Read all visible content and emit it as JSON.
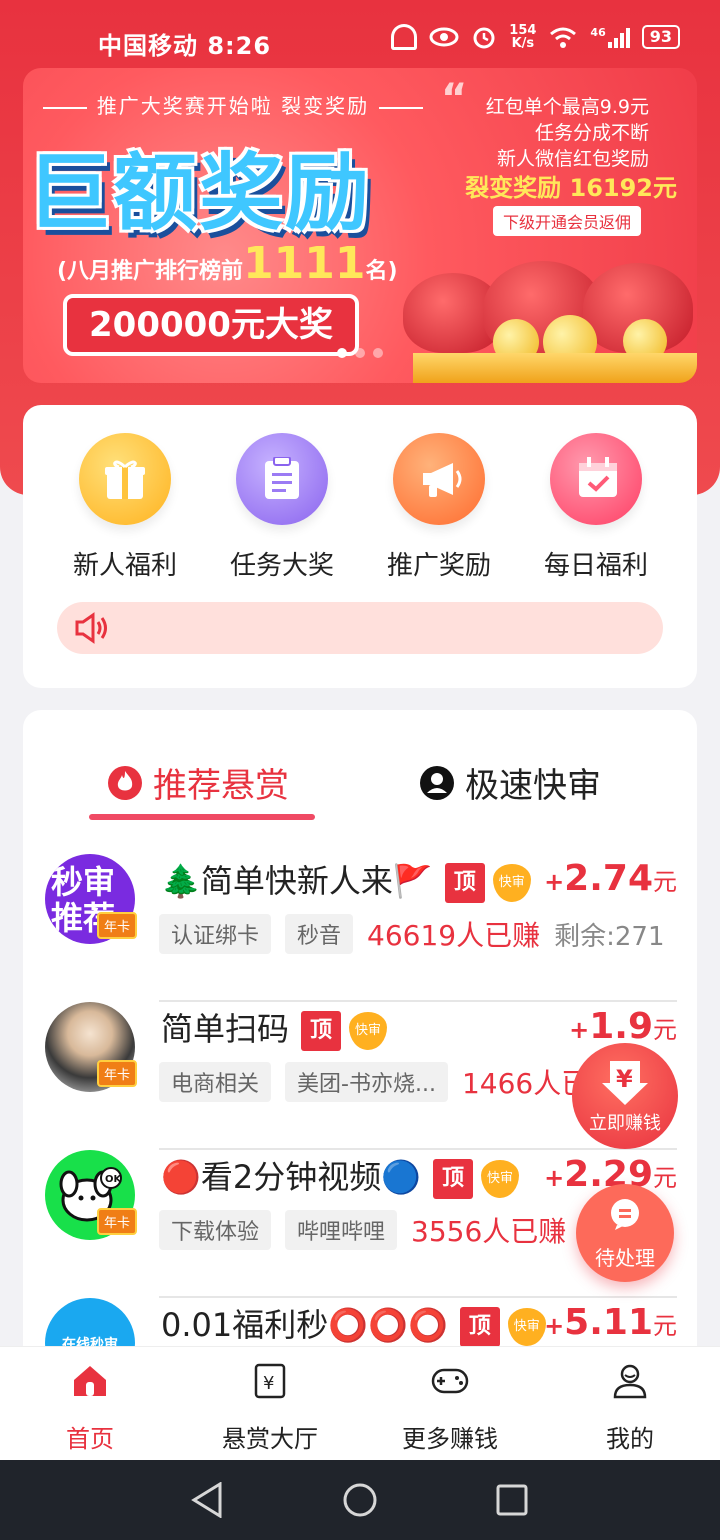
{
  "status_bar": {
    "carrier_time": "中国移动 8:26",
    "net_speed_value": "154",
    "net_speed_unit": "K/s",
    "net_type": "46",
    "battery": "93"
  },
  "banner": {
    "tagline": "推广大奖赛开始啦  裂变奖励",
    "headline": "巨额奖励",
    "rank_prefix": "(八月推广排行榜前",
    "rank_number": "1111",
    "rank_suffix": "名)",
    "prize": "200000元大奖",
    "right_line1": "红包单个最高9.9元",
    "right_line2": "任务分成不断",
    "right_line3": "新人微信红包奖励",
    "right_highlight": "裂变奖励 16192元",
    "right_button": "下级开通会员返佣",
    "active_slide": 1,
    "slide_count": 3
  },
  "quick_menu": {
    "items": [
      {
        "label": "新人福利",
        "icon": "gift-icon",
        "color": "#ffc43d"
      },
      {
        "label": "任务大奖",
        "icon": "clipboard-icon",
        "color": "#9b7bf4"
      },
      {
        "label": "推广奖励",
        "icon": "megaphone-icon",
        "color": "#ff8a3d"
      },
      {
        "label": "每日福利",
        "icon": "calendar-check-icon",
        "color": "#ff5b78"
      }
    ],
    "notice_icon": "speaker-icon"
  },
  "tabs": {
    "recommended": "推荐悬赏",
    "fast_review": "极速快审"
  },
  "task_labels": {
    "top_tag": "顶",
    "fast_tag": "快审",
    "year_badge": "年卡",
    "plus": "+",
    "unit": "元"
  },
  "tasks": [
    {
      "avatar_text": "秒审推荐",
      "title": "🌲简单快新人来🚩",
      "price": "2.74",
      "tags": [
        "认证绑卡",
        "秒音"
      ],
      "earned": "46619人已赚",
      "remaining": "剩余:271"
    },
    {
      "avatar_text": "",
      "title": "简单扫码",
      "price": "1.9",
      "tags": [
        "电商相关",
        "美团-书亦烧..."
      ],
      "earned": "1466人已赚",
      "remaining": ""
    },
    {
      "avatar_text": "OK",
      "title": "🔴看2分钟视频🔵",
      "price": "2.29",
      "tags": [
        "下载体验",
        "哔哩哔哩"
      ],
      "earned": "3556人已赚",
      "remaining": ""
    },
    {
      "avatar_text": "在线秒审",
      "title": "0.01福利秒⭕⭕⭕",
      "price": "5.11",
      "tags": [],
      "earned": "",
      "remaining": ""
    }
  ],
  "floating": {
    "earn_now": "立即赚钱",
    "pending": "待处理"
  },
  "bottom_nav": {
    "items": [
      {
        "label": "首页",
        "icon": "home-icon",
        "active": true
      },
      {
        "label": "悬赏大厅",
        "icon": "bounty-hall-icon",
        "active": false
      },
      {
        "label": "更多赚钱",
        "icon": "gamepad-icon",
        "active": false
      },
      {
        "label": "我的",
        "icon": "profile-icon",
        "active": false
      }
    ]
  },
  "colors": {
    "accent": "#e8323f",
    "tab_underline": "#f04a64",
    "notice_bg": "#ffe0dc"
  }
}
